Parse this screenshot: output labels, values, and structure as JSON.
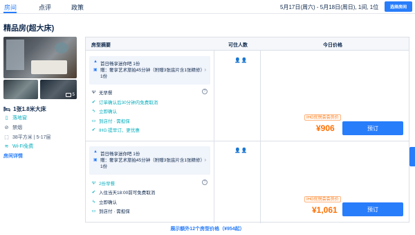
{
  "tabs": [
    {
      "label": "房间",
      "active": true
    },
    {
      "label": "点评",
      "active": false
    },
    {
      "label": "政策",
      "active": false
    }
  ],
  "booking": {
    "summary": "5月17日(周六) - 5月18日(周日), 1间, 1位",
    "select_room_label": "选择房间"
  },
  "room": {
    "title": "精品房(超大床)",
    "photo_count": "5",
    "bed": "1张1.8米大床",
    "features": [
      {
        "icon": "window-icon",
        "label": "落地窗"
      },
      {
        "icon": "no-smoking-icon",
        "label": "禁烟"
      },
      {
        "icon": "area-icon",
        "label": "38平方米 | 5-17层"
      },
      {
        "icon": "wifi-icon",
        "label": "Wi-Fi免费"
      }
    ],
    "details_link": "房间详情"
  },
  "table": {
    "headers": {
      "summary": "房型摘要",
      "occupancy": "可住人数",
      "price": "今日价格"
    },
    "rows": [
      {
        "perks": [
          "首日畅享迷你吧 1份",
          "赠：奢享艺术旅拍45分钟（附赠3张底片含1张精修）1份"
        ],
        "policies": [
          {
            "icon": "utensils-icon",
            "label": "无早餐",
            "style": "dark"
          },
          {
            "icon": "check-circle-icon",
            "label": "订单确认后30分钟内免费取消",
            "style": "green"
          },
          {
            "icon": "lightning-icon",
            "label": "立即确认",
            "style": "green"
          },
          {
            "icon": "card-icon",
            "label": "到店付 · 需担保",
            "style": "green"
          },
          {
            "icon": "check-circle-icon",
            "label": "IHG 提早订、更优惠",
            "style": "green"
          }
        ],
        "occupants": "👤👤",
        "price_tag": "IHG优悦会会员价",
        "price": "¥906",
        "book_label": "预订"
      },
      {
        "perks": [
          "首日畅享迷你吧 1份",
          "赠：奢享艺术旅拍45分钟（附赠3张底片含1张精修）1份"
        ],
        "policies": [
          {
            "icon": "utensils-icon",
            "label": "2份早餐",
            "style": "green"
          },
          {
            "icon": "check-circle-icon",
            "label": "入住当天18:00前可免费取消",
            "style": "dark"
          },
          {
            "icon": "lightning-icon",
            "label": "立即确认",
            "style": "dark"
          },
          {
            "icon": "card-icon",
            "label": "到店付 · 需担保",
            "style": "dark"
          }
        ],
        "occupants": "👤👤",
        "price_tag": "IHG优悦会会员价",
        "price": "¥1,061",
        "book_label": "预订"
      }
    ]
  },
  "show_more": "展示额外12个房型价格（¥954起）",
  "colors": {
    "accent": "#287dfa",
    "price": "#ff6f00",
    "green": "#06aebd",
    "text": "#0f294d"
  }
}
